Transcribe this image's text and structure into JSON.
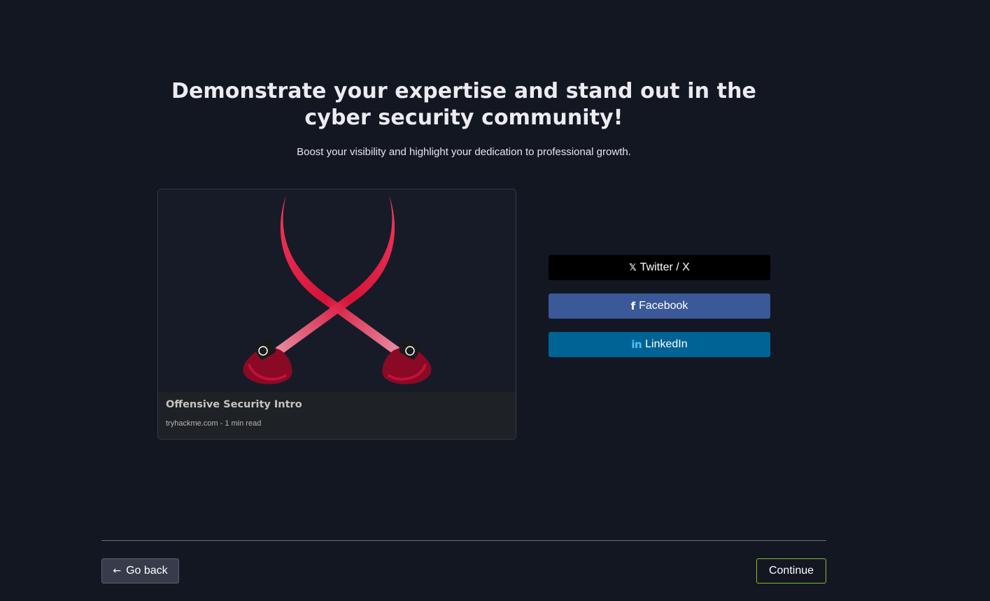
{
  "header": {
    "title": "Demonstrate your expertise and stand out in the cyber security community!",
    "subtitle": "Boost your visibility and highlight your dedication to professional growth."
  },
  "preview_card": {
    "image_icon": "crossed-swords-icon",
    "title": "Offensive Security Intro",
    "meta": "tryhackme.com - 1 min read"
  },
  "share": {
    "twitter": {
      "label": "Twitter / X",
      "icon": "x-logo-icon",
      "color": "#000000"
    },
    "facebook": {
      "label": "Facebook",
      "icon": "facebook-icon",
      "color": "#3b5998"
    },
    "linkedin": {
      "label": "LinkedIn",
      "icon": "linkedin-icon",
      "color": "#006396"
    }
  },
  "footer": {
    "back_label": "Go back",
    "back_icon": "arrow-left-icon",
    "continue_label": "Continue",
    "continue_border_color": "#7fbf2a"
  },
  "colors": {
    "background": "#131722",
    "sword_red": "#e0123a"
  }
}
